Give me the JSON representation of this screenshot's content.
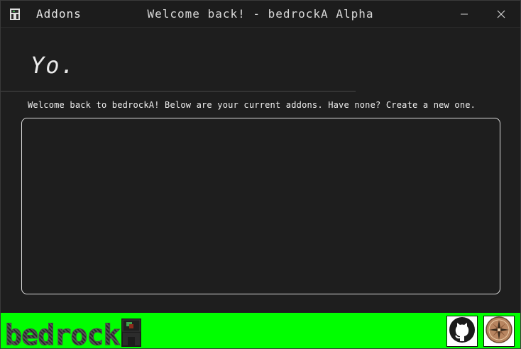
{
  "titlebar": {
    "menu_label": "Addons",
    "title": "Welcome back! - bedrockA Alpha",
    "icons": [
      "app-icon",
      "minimize-icon",
      "close-icon"
    ]
  },
  "main": {
    "heading": "Yo.",
    "subtitle": "Welcome back to bedrockA! Below are your current addons. Have none? Create a new one."
  },
  "footer": {
    "brand_text": "bedrock",
    "background": "#00ff00",
    "icons": [
      "github-icon",
      "compass-icon"
    ]
  }
}
